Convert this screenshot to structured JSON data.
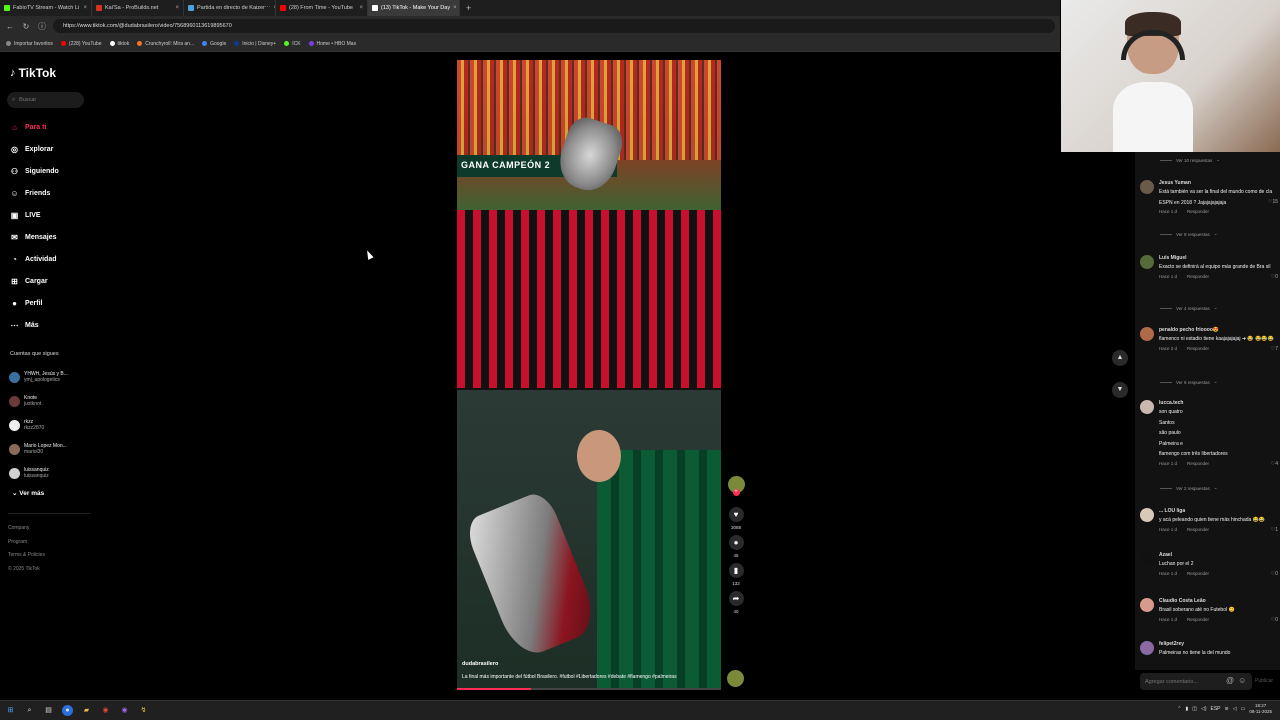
{
  "browser": {
    "tabs": [
      {
        "label": "FabioTV Stream - Watch Li",
        "color": "#53fc18",
        "active": false
      },
      {
        "label": "Kai'Sa - ProBuilds.net",
        "color": "#d9301f",
        "active": false
      },
      {
        "label": "Partida en directo de Kaizer⋯",
        "color": "#4aa3df",
        "active": false
      },
      {
        "label": "(28) From Time - YouTube",
        "color": "#ff0000",
        "active": false
      },
      {
        "label": "(13) TikTok - Make Your Day",
        "color": "#ffffff",
        "active": true
      }
    ],
    "url": "https://www.tiktok.com/@dudabrasilero/video/7568960113619895670",
    "bookmarks": [
      {
        "label": "Importar favoritos",
        "color": "#888888"
      },
      {
        "label": "(228) YouTube",
        "color": "#ff0000"
      },
      {
        "label": "tiktok",
        "color": "#ffffff"
      },
      {
        "label": "Crunchyroll: Mira an...",
        "color": "#f47521"
      },
      {
        "label": "Google",
        "color": "#4285f4"
      },
      {
        "label": "Inicio | Disney+",
        "color": "#0b3a8f"
      },
      {
        "label": "ICK",
        "color": "#53fc18"
      },
      {
        "label": "Home • HBO Max",
        "color": "#7c3aed"
      }
    ]
  },
  "sidebar": {
    "logo": "TikTok",
    "search_placeholder": "Buscar",
    "nav": [
      {
        "label": "Para ti",
        "icon": "home-icon",
        "glyph": "⌂",
        "active": true
      },
      {
        "label": "Explorar",
        "icon": "compass-icon",
        "glyph": "◎",
        "active": false
      },
      {
        "label": "Siguiendo",
        "icon": "following-icon",
        "glyph": "⚇",
        "active": false
      },
      {
        "label": "Friends",
        "icon": "friends-icon",
        "glyph": "☺",
        "active": false
      },
      {
        "label": "LIVE",
        "icon": "live-icon",
        "glyph": "▣",
        "active": false
      },
      {
        "label": "Mensajes",
        "icon": "messages-icon",
        "glyph": "✉",
        "active": false
      },
      {
        "label": "Actividad",
        "icon": "activity-icon",
        "glyph": "◔",
        "active": false
      },
      {
        "label": "Cargar",
        "icon": "upload-icon",
        "glyph": "⊞",
        "active": false
      },
      {
        "label": "Perfil",
        "icon": "profile-icon",
        "glyph": "●",
        "active": false
      },
      {
        "label": "Más",
        "icon": "more-icon",
        "glyph": "⋯",
        "active": false
      }
    ],
    "following_title": "Cuentas que sigues",
    "following": [
      {
        "name": "YHWH, Jesús y B...",
        "handle": "ymj_apologetics",
        "color": "#3b6fa0"
      },
      {
        "name": "Knote",
        "handle": "justknot",
        "color": "#6a3a3a"
      },
      {
        "name": "rkzz",
        "handle": "rkzz2870",
        "color": "#eeeeee"
      },
      {
        "name": "Mario Lopez Mon...",
        "handle": "mariol30",
        "color": "#8a6a5a"
      },
      {
        "name": "luissanquiz",
        "handle": "luissanquiz",
        "color": "#d0d0d0"
      }
    ],
    "see_more": "Ver más",
    "footer": [
      "Company",
      "Program",
      "Terms & Policies",
      "© 2025 TikTok"
    ]
  },
  "video": {
    "banner_text": "GANA CAMPEÓN 2",
    "username": "dudabrasilero",
    "caption": "La final más importante del fútbol Brasilero. #futbol #Libertadores #debate #flamengo #palmeiras",
    "progress": 0.28,
    "likes": "3088",
    "comments": "45",
    "saves": "132",
    "shares": "40"
  },
  "comments": [
    {
      "type": "replies",
      "text": "Ver 10 respuestas"
    },
    {
      "type": "comment",
      "name": "Jesus Yuman",
      "text": [
        "Está también va ser la final del mundo como de cla ESPN en 2018 ? Jajajajajajaja"
      ],
      "time": "Hace 1 d",
      "reply": "Responder",
      "likes": "15",
      "color": "#6a5a4a"
    },
    {
      "type": "replies",
      "text": "Ver 8 respuestas"
    },
    {
      "type": "comment",
      "name": "Luis Miguel",
      "text": [
        "Exacto se definirá al equipo más grande de Bra sil"
      ],
      "time": "Hace 1 d",
      "reply": "Responder",
      "likes": "0",
      "color": "#556b3a"
    },
    {
      "type": "replies",
      "text": "Ver 4 respuestas"
    },
    {
      "type": "comment",
      "name": "penaldo pecho frioooo😍",
      "text": [
        "flamenco ni estadio tiene kaajajajajaj ➜ 😂 😂😂😂"
      ],
      "time": "Hace 2 d",
      "reply": "Responder",
      "likes": "7",
      "color": "#b06a4a"
    },
    {
      "type": "replies",
      "text": "Ver 6 respuestas"
    },
    {
      "type": "comment",
      "name": "lucca.tech",
      "text": [
        "son quatro",
        "Santos",
        "são paulo",
        "Palmeira e",
        "flamengo com três libertadores"
      ],
      "time": "Hace 1 d",
      "reply": "Responder",
      "likes": "4",
      "color": "#c9b8b0"
    },
    {
      "type": "replies",
      "text": "Ver 2 respuestas"
    },
    {
      "type": "comment",
      "name": "... LOU liga",
      "text": [
        "y acá peleando quien tiene más hinchada 😂😂"
      ],
      "time": "Hace 1 d",
      "reply": "Responder",
      "likes": "1",
      "color": "#d8c8b8"
    },
    {
      "type": "comment",
      "name": "Azael",
      "text": [
        "Luchan por el 2"
      ],
      "time": "Hace 1 d",
      "reply": "Responder",
      "likes": "0",
      "color": "#111111"
    },
    {
      "type": "comment",
      "name": "Claudio Costa Leão",
      "text": [
        "Brasil soberano até no Futebol 😊"
      ],
      "time": "Hace 1 d",
      "reply": "Responder",
      "likes": "0",
      "color": "#d89a8a"
    },
    {
      "type": "comment",
      "name": "felipet2rey",
      "text": [
        "Palmeiras no tiene la del mundo"
      ],
      "time": "",
      "reply": "",
      "likes": "",
      "color": "#8a6aa0"
    }
  ],
  "comment_input_placeholder": "Agregar comentario...",
  "publish_label": "Publicar",
  "clock": {
    "time": "18:27",
    "date": "08-11-2025"
  },
  "tray_lang": "ESP"
}
